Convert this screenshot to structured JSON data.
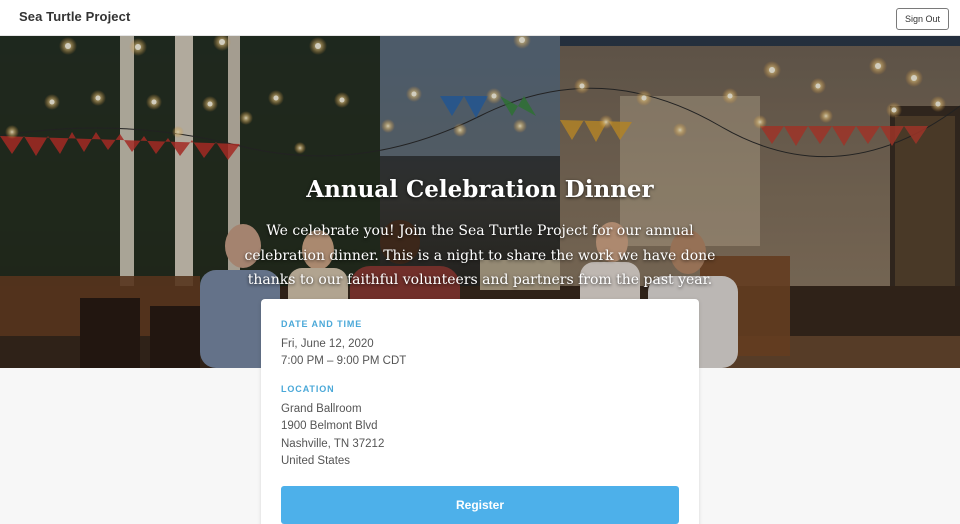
{
  "header": {
    "brand": "Sea Turtle Project",
    "signout_label": "Sign Out"
  },
  "hero": {
    "title": "Annual Celebration Dinner",
    "description": "We celebrate you! Join the Sea Turtle Project for our annual celebration dinner. This is a night to share the work we have done thanks to our faithful volunteers and partners from the past year."
  },
  "details": {
    "date_time": {
      "label": "DATE AND TIME",
      "date": "Fri, June 12, 2020",
      "time": "7:00 PM – 9:00 PM CDT"
    },
    "location": {
      "label": "LOCATION",
      "venue": "Grand Ballroom",
      "street": "1900 Belmont Blvd",
      "city": "Nashville, TN 37212",
      "country": "United States"
    },
    "register_label": "Register"
  },
  "colors": {
    "accent": "#4db0ea",
    "label_blue": "#4aa8d8"
  }
}
